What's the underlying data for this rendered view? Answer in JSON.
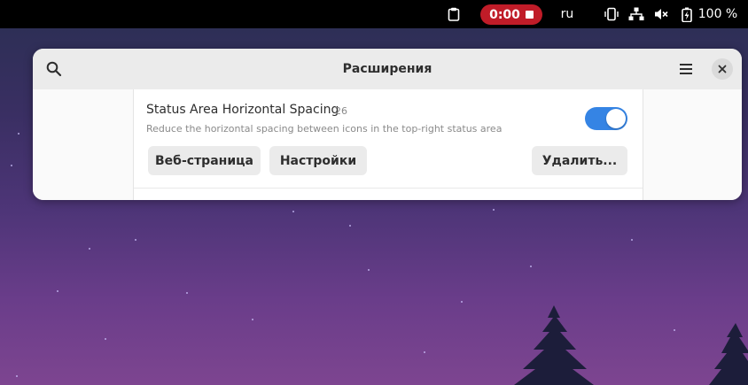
{
  "topbar": {
    "recording_time": "0:00",
    "keyboard_layout": "ru",
    "battery_percent": "100 %",
    "icons": [
      "clipboard-icon",
      "record-stop-icon",
      "screen-rotation-icon",
      "network-wired-icon",
      "volume-muted-icon",
      "battery-charging-icon"
    ]
  },
  "window": {
    "title": "Расширения",
    "header_icons": [
      "search-icon",
      "hamburger-menu-icon",
      "close-icon"
    ],
    "extension": {
      "name": "Status Area Horizontal Spacing",
      "version": "26",
      "description": "Reduce the horizontal spacing between icons in the top-right status area",
      "enabled": true,
      "buttons": {
        "website": "Веб-страница",
        "settings": "Настройки",
        "remove": "Удалить..."
      }
    }
  },
  "colors": {
    "accent": "#3584e4",
    "recording": "#c01c28"
  }
}
